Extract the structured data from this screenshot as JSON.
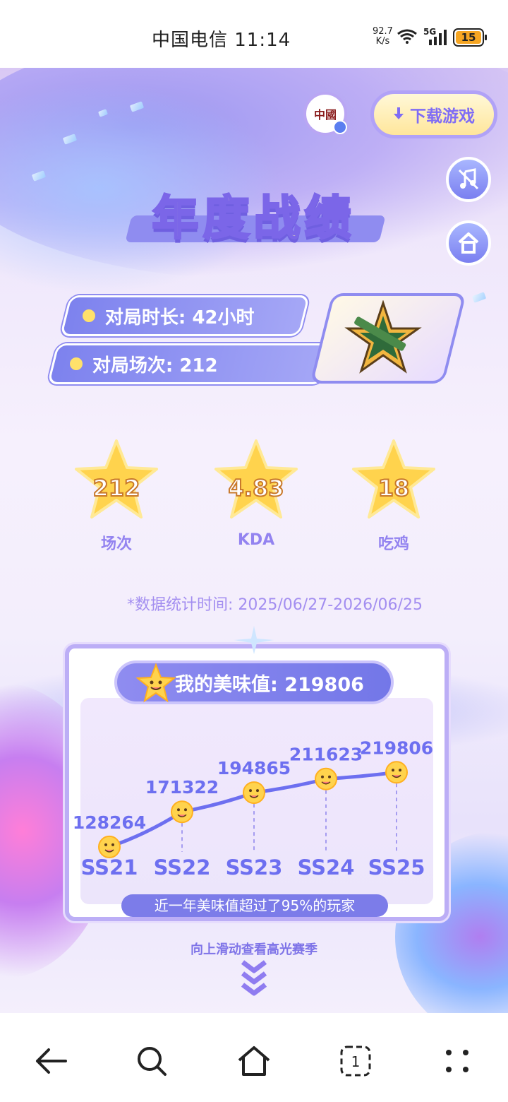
{
  "status_bar": {
    "carrier_time": "中国电信 11:14",
    "net_speed_value": "92.7",
    "net_speed_unit": "K/s",
    "signal_label": "5G",
    "battery": "15"
  },
  "header": {
    "logo_text": "中國",
    "download_label": "下载游戏",
    "music_icon": "music-off-icon",
    "home_icon": "home-icon"
  },
  "title": "年度战绩",
  "stats": {
    "duration_label": "对局时长: 42小时",
    "matches_label": "对局场次: 212"
  },
  "stars": [
    {
      "value": "212",
      "label": "场次"
    },
    {
      "value": "4.83",
      "label": "KDA"
    },
    {
      "value": "18",
      "label": "吃鸡"
    }
  ],
  "stat_period": "*数据统计时间: 2025/06/27-2026/06/25",
  "score": {
    "label": "我的美味值: 219806"
  },
  "chart_data": {
    "type": "line",
    "categories": [
      "SS21",
      "SS22",
      "SS23",
      "SS24",
      "SS25"
    ],
    "values": [
      128264,
      171322,
      194865,
      211623,
      219806
    ],
    "title": "",
    "xlabel": "",
    "ylabel": ""
  },
  "summary": "近一年美味值超过了95%的玩家",
  "scroll_hint": "向上滑动查看高光赛季",
  "colors": {
    "accent": "#7c7ce9",
    "chart_line": "#6d6ff0",
    "gold": "#ffd34d"
  },
  "bottom_nav": {
    "tabs_count": "1"
  }
}
